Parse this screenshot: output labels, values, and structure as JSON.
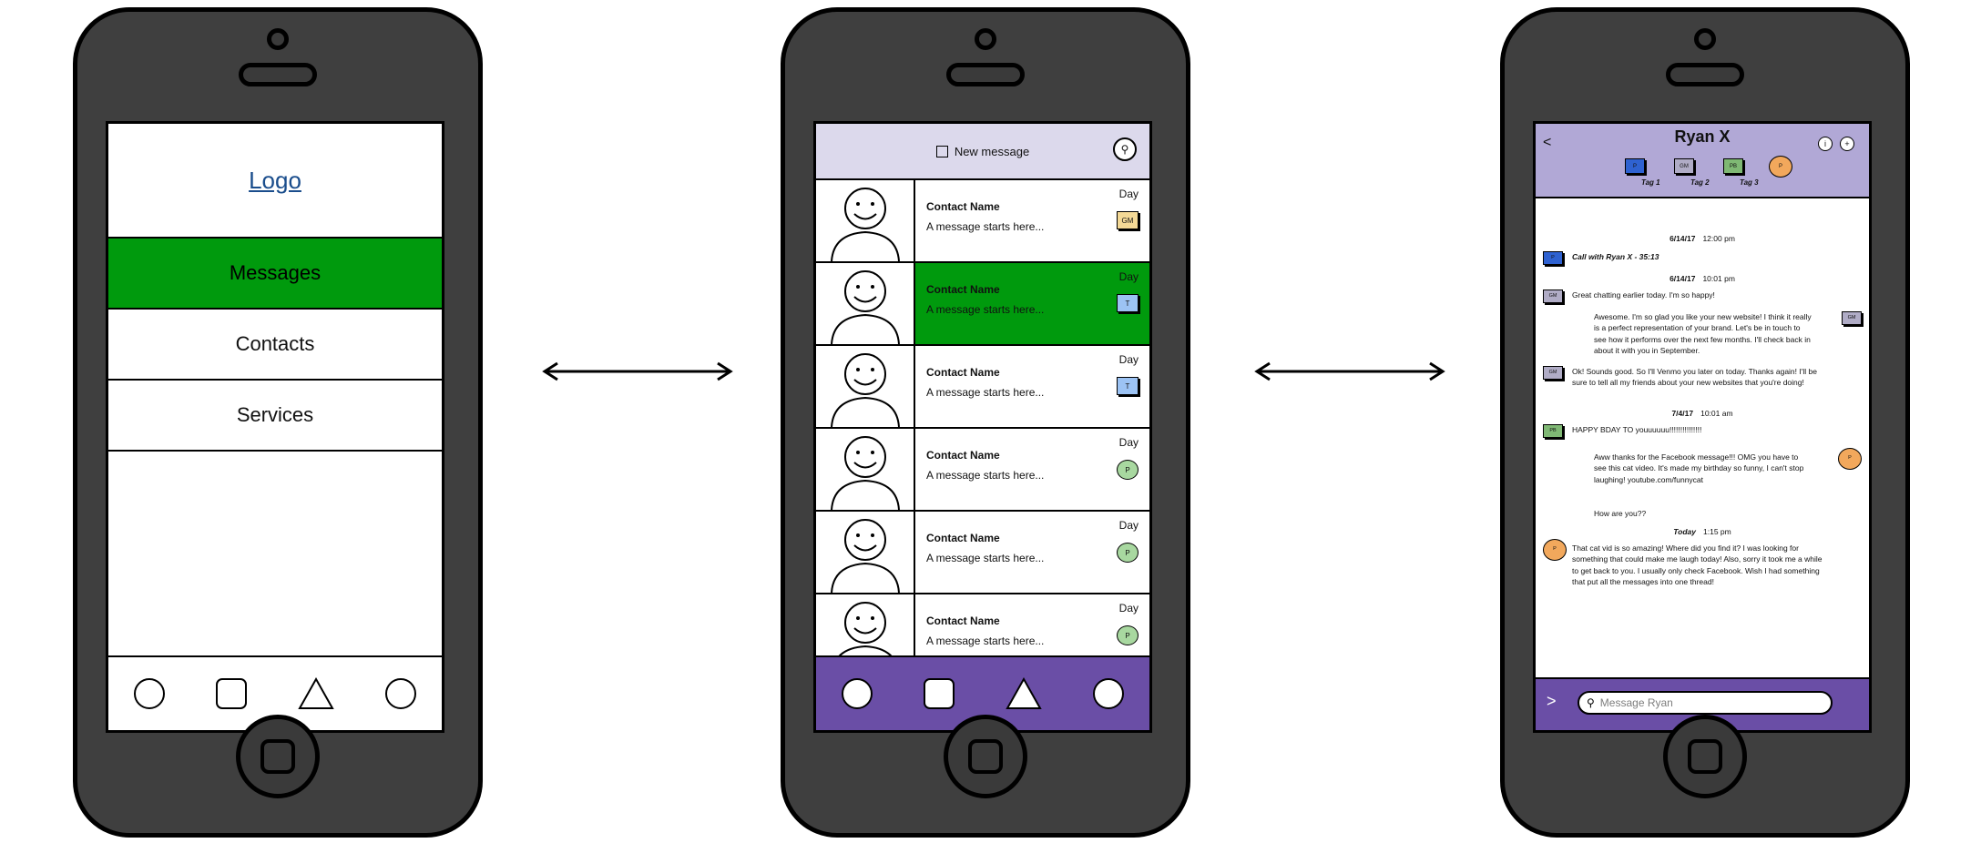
{
  "colors": {
    "green": "#009a0d",
    "purple": "#6a4ea6",
    "lavender": "#b1a8d6",
    "header_lavender": "#dcd9ec",
    "phone": "#3f3f3f"
  },
  "screen1": {
    "logo": "Logo",
    "menu": [
      "Messages",
      "Contacts",
      "Services"
    ],
    "active_item": "Messages",
    "nav_icons": [
      "circle-icon",
      "square-icon",
      "triangle-icon",
      "circle-icon"
    ]
  },
  "screen2": {
    "header": {
      "label": "New message",
      "search_icon": "search-icon"
    },
    "contacts": [
      {
        "name": "Contact Name",
        "message": "A message starts here...",
        "day": "Day",
        "tag": "GM",
        "tag_color": "#f4d996",
        "tag_shape": "square",
        "active": false
      },
      {
        "name": "Contact Name",
        "message": "A message starts here...",
        "day": "Day",
        "tag": "T",
        "tag_color": "#9cc3f4",
        "tag_shape": "square",
        "active": true
      },
      {
        "name": "Contact Name",
        "message": "A message starts here...",
        "day": "Day",
        "tag": "T",
        "tag_color": "#9cc3f4",
        "tag_shape": "square",
        "active": false
      },
      {
        "name": "Contact Name",
        "message": "A message starts here...",
        "day": "Day",
        "tag": "P",
        "tag_color": "#a8d8a0",
        "tag_shape": "circle",
        "active": false
      },
      {
        "name": "Contact Name",
        "message": "A message starts here...",
        "day": "Day",
        "tag": "P",
        "tag_color": "#a8d8a0",
        "tag_shape": "circle",
        "active": false
      },
      {
        "name": "Contact Name",
        "message": "A message starts here...",
        "day": "Day",
        "tag": "P",
        "tag_color": "#a8d8a0",
        "tag_shape": "circle",
        "active": false
      }
    ]
  },
  "screen3": {
    "back": "<",
    "title": "Ryan X",
    "info": "i",
    "add": "+",
    "tags": [
      {
        "label": "P",
        "color": "#2f62d1"
      },
      {
        "label": "GM",
        "color": "#b0acc6"
      },
      {
        "label": "PB",
        "color": "#7fb874"
      },
      {
        "label": "P",
        "color": "#f2a85c"
      }
    ],
    "tag_labels": [
      "Tag 1",
      "Tag 2",
      "Tag 3"
    ],
    "messages": [
      {
        "date": "6/14/17",
        "time": "12:00 pm"
      },
      {
        "tag": "P",
        "tag_color": "#2f62d1",
        "text": "Call with Ryan X - 35:13"
      },
      {
        "date": "6/14/17",
        "time": "10:01 pm"
      },
      {
        "tag": "GM",
        "tag_color": "#b0acc6",
        "text": "Great chatting earlier today. I'm so happy!"
      },
      {
        "tag": "GM",
        "tag_color": "#b0acc6",
        "text": "Awesome. I'm so glad you like your new website! I think it really is a perfect representation of your brand. Let's be in touch to see how it performs over the next few months. I'll check back in about it with you in September."
      },
      {
        "tag": "GM",
        "tag_color": "#b0acc6",
        "text": "Ok! Sounds good. So I'll Venmo you later on today. Thanks again! I'll be sure to tell all my friends about your new websites that you're doing!"
      },
      {
        "date": "7/4/17",
        "time": "10:01 am"
      },
      {
        "tag": "PB",
        "tag_color": "#7fb874",
        "text": "HAPPY BDAY TO youuuuuu!!!!!!!!!!!!!!!"
      },
      {
        "tag": "P",
        "tag_color": "#f2a85c",
        "text": "Aww thanks for the Facebook message!!! OMG you have to see this cat video. It's made my birthday so funny, I can't stop laughing! youtube.com/funnycat"
      },
      {
        "text": "How are you??"
      },
      {
        "date": "Today",
        "time": "1:15 pm"
      },
      {
        "tag": "P",
        "tag_color": "#f2a85c",
        "text": "That cat vid is so amazing! Where did you find it? I was looking for something that could make me laugh today! Also, sorry it took me a while to get back to you. I usually only check Facebook. Wish I had something that put all the messages into one thread!"
      }
    ],
    "footer": {
      "send": ">",
      "placeholder": "Message Ryan"
    }
  }
}
